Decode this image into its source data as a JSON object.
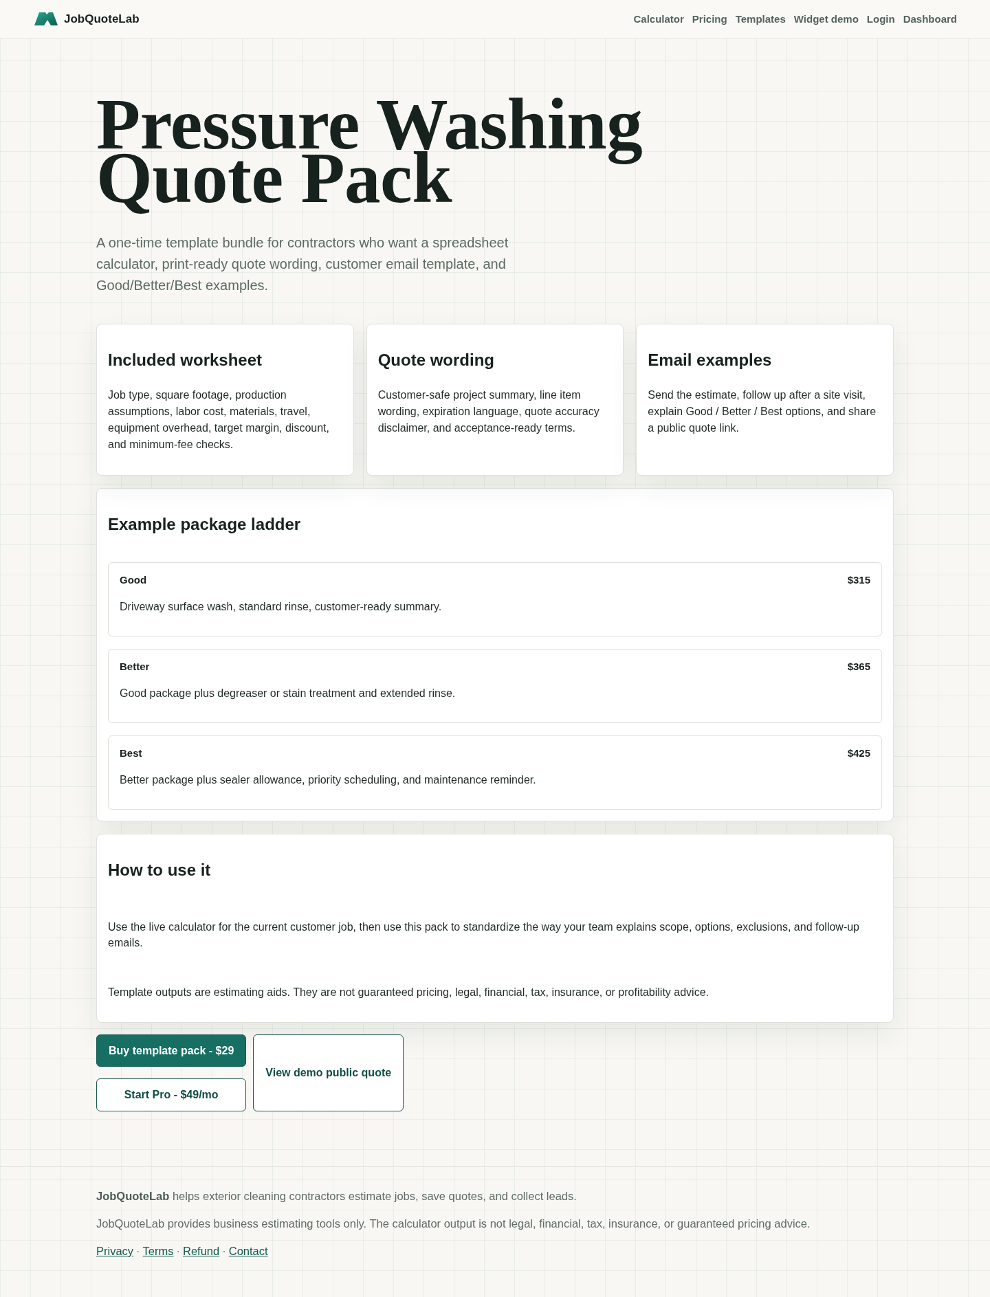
{
  "header": {
    "brand": "JobQuoteLab",
    "nav": [
      "Calculator",
      "Pricing",
      "Templates",
      "Widget demo",
      "Login",
      "Dashboard"
    ]
  },
  "hero": {
    "title": "Pressure Washing Quote Pack",
    "subtitle": "A one-time template bundle for contractors who want a spreadsheet calculator, print-ready quote wording, customer email template, and Good/Better/Best examples."
  },
  "features": [
    {
      "title": "Included worksheet",
      "text": "Job type, square footage, production assumptions, labor cost, materials, travel, equipment overhead, target margin, discount, and minimum-fee checks."
    },
    {
      "title": "Quote wording",
      "text": "Customer-safe project summary, line item wording, expiration language, quote accuracy disclaimer, and acceptance-ready terms."
    },
    {
      "title": "Email examples",
      "text": "Send the estimate, follow up after a site visit, explain Good / Better / Best options, and share a public quote link."
    }
  ],
  "package_ladder": {
    "title": "Example package ladder",
    "packages": [
      {
        "name": "Good",
        "price": "$315",
        "description": "Driveway surface wash, standard rinse, customer-ready summary."
      },
      {
        "name": "Better",
        "price": "$365",
        "description": "Good package plus degreaser or stain treatment and extended rinse."
      },
      {
        "name": "Best",
        "price": "$425",
        "description": "Better package plus sealer allowance, priority scheduling, and maintenance reminder."
      }
    ]
  },
  "how_to_use": {
    "title": "How to use it",
    "paragraphs": [
      "Use the live calculator for the current customer job, then use this pack to standardize the way your team explains scope, options, exclusions, and follow-up emails.",
      "Template outputs are estimating aids. They are not guaranteed pricing, legal, financial, tax, insurance, or profitability advice."
    ]
  },
  "actions": [
    {
      "label": "Buy template pack - $29",
      "kind": "primary"
    },
    {
      "label": "Start Pro - $49/mo",
      "kind": "secondary"
    },
    {
      "label": "View demo public quote",
      "kind": "secondary"
    }
  ],
  "footer": {
    "about": "**JobQuoteLab** helps exterior cleaning contractors estimate jobs, save quotes, and collect leads.",
    "disclaimer": "JobQuoteLab provides business estimating tools only. The calculator output is not legal, financial, tax, insurance, or guaranteed pricing advice.",
    "links": [
      "Privacy",
      "Terms",
      "Refund",
      "Contact"
    ],
    "separators": [
      "·",
      "·",
      "·"
    ]
  }
}
